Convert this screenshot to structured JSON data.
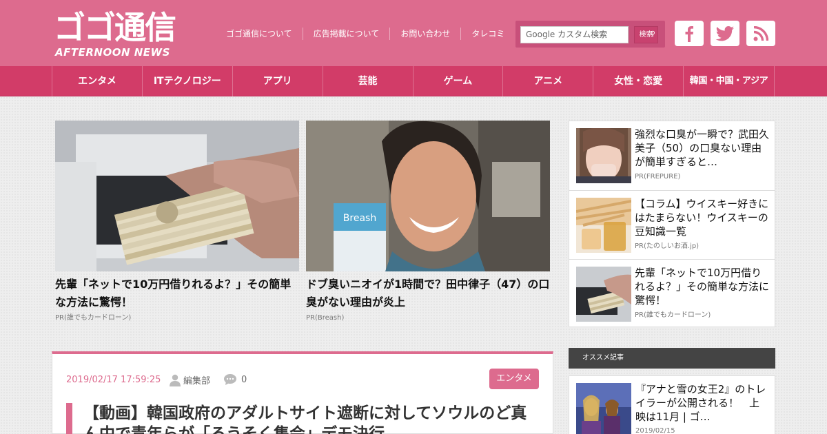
{
  "header": {
    "logo_main": "ゴゴ通信",
    "logo_sub": "AFTERNOON NEWS",
    "links": [
      "ゴゴ通信について",
      "広告掲載について",
      "お問い合わせ",
      "タレコミ"
    ],
    "search_placeholder": "Google カスタム検索",
    "search_button": "検索"
  },
  "nav": [
    "エンタメ",
    "ITテクノロジー",
    "アプリ",
    "芸能",
    "ゲーム",
    "アニメ",
    "女性・恋愛",
    "韓国・中国・アジア"
  ],
  "featured": [
    {
      "title": "先輩「ネットで10万円借りれるよ？」その簡単な方法に驚愕！",
      "source": "PR(誰でもカードローン)"
    },
    {
      "title": "ドブ臭いニオイが1時間で？田中律子（47）の口臭がない理由が炎上",
      "source": "PR(Breash)"
    }
  ],
  "sidebar_pr": [
    {
      "title": "強烈な口臭が一瞬で？武田久美子（50）の口臭ない理由が簡単すぎると…",
      "source": "PR(FREPURE)"
    },
    {
      "title": "【コラム】ウイスキー好きにはたまらない！ウイスキーの豆知識一覧",
      "source": "PR(たのしいお酒.jp)"
    },
    {
      "title": "先輩「ネットで10万円借りれるよ？」その簡単な方法に驚愕！",
      "source": "PR(誰でもカードローン)"
    }
  ],
  "recommended": {
    "heading": "オススメ記事",
    "items": [
      {
        "title": "『アナと雪の女王2』のトレイラーが公開される！　上映は11月 | ゴ…",
        "date": "2019/02/15"
      }
    ]
  },
  "article": {
    "date": "2019/02/17 17:59:25",
    "author": "編集部",
    "comments": "0",
    "category": "エンタメ",
    "title": "【動画】韓国政府のアダルトサイト遮断に対してソウルのど真ん中で青年らが「ろうそく集会」デモ決行"
  },
  "colors": {
    "header_bg": "#dd6b8e",
    "nav_bg": "#d23c68",
    "accent": "#dd6b8e"
  }
}
